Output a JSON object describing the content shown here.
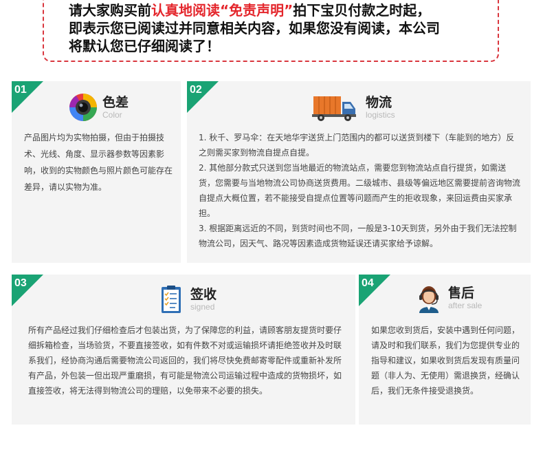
{
  "notice": {
    "line1_a": "请大家购买前",
    "line1_red": "认真地阅读“免责声明”",
    "line1_b": "拍下宝贝付款之时起，",
    "line2": "即表示您已阅读过并同意相关内容，如果您没有阅读，本公司",
    "line3": "将默认您已仔细阅读了！"
  },
  "colors": {
    "accent_green": "#1aa374",
    "notice_red": "#e4262c",
    "card_bg": "#f4f4f4"
  },
  "cards": [
    {
      "number": "01",
      "title": "色差",
      "subtitle": "Color",
      "icon": "camera-lens-icon",
      "paragraphs": [
        "产品图片均为实物拍摄，但由于拍摄技术、光线、角度、显示器参数等因素影响，收到的实物颜色与照片颜色可能存在差异，请以实物为准。"
      ]
    },
    {
      "number": "02",
      "title": "物流",
      "subtitle": "logistics",
      "icon": "delivery-truck-icon",
      "paragraphs": [
        "1. 秋千、罗马伞：在天地华宇送货上门范围内的都可以送货到楼下（车能到的地方）反之则需买家到物流自提点自提。",
        "2. 其他部分款式只送到您当地最近的物流站点，需要您到物流站点自行提货，如需送货，您需要与当地物流公司协商送货费用。二级城市、县级等偏远地区需要提前咨询物流自提点大概位置，若不能接受自提点位置等问题而产生的拒收现象，来回运费由买家承担。",
        "3. 根据距离远近的不同，到货时间也不同，一般是3-10天到货，另外由于我们无法控制物流公司，因天气、路况等因素造成货物延误还请买家给予谅解。"
      ]
    },
    {
      "number": "03",
      "title": "签收",
      "subtitle": "signed",
      "icon": "clipboard-checklist-icon",
      "paragraphs": [
        "所有产品经过我们仔细检查后才包装出货，为了保障您的利益，请顾客朋友提货时要仔细拆箱检查，当场验货，不要直接签收，如有件数不对或运输损坏请拒绝签收并及时联系我们，经协商沟通后需要物流公司返回的，我们将尽快免费邮寄零配件或重新补发所有产品，外包装一但出现严重磨损，有可能是物流公司运输过程中造成的货物损坏，如直接签收，将无法得到物流公司的理赔，以免带来不必要的损失。"
      ]
    },
    {
      "number": "04",
      "title": "售后",
      "subtitle": "after sale",
      "icon": "customer-service-agent-icon",
      "paragraphs": [
        "如果您收到货后，安装中遇到任何问题，请及时和我们联系，我们为您提供专业的指导和建议，如果收到货后发现有质量问题（非人为、无使用）需退换货，经确认后，我们无条件接受退换货。"
      ]
    }
  ]
}
